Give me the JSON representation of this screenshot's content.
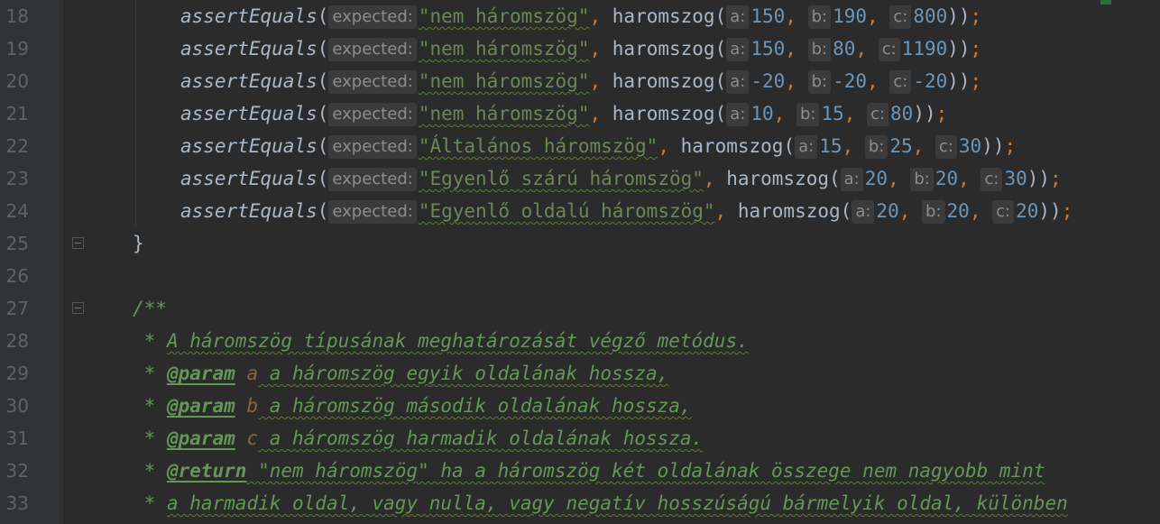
{
  "editor": {
    "lines": [
      {
        "num": "18",
        "method": "assertEquals",
        "hint_expected": "expected:",
        "expected": "\"nem háromszög\"",
        "func": "haromszog",
        "a": "150",
        "b": "190",
        "c": "800",
        "close": "));"
      },
      {
        "num": "19",
        "method": "assertEquals",
        "hint_expected": "expected:",
        "expected": "\"nem háromszög\"",
        "func": "haromszog",
        "a": "150",
        "b": "80",
        "c": "1190",
        "close": "));"
      },
      {
        "num": "20",
        "method": "assertEquals",
        "hint_expected": "expected:",
        "expected": "\"nem háromszög\"",
        "func": "haromszog",
        "a": "-20",
        "b": "-20",
        "c": "-20",
        "close": "));"
      },
      {
        "num": "21",
        "method": "assertEquals",
        "hint_expected": "expected:",
        "expected": "\"nem háromszög\"",
        "func": "haromszog",
        "a": "10",
        "b": "15",
        "c": "80",
        "close": "));"
      },
      {
        "num": "22",
        "method": "assertEquals",
        "hint_expected": "expected:",
        "expected": "\"Általános háromszög\"",
        "func": "haromszog",
        "a": "15",
        "b": "25",
        "c": "30",
        "close": "));"
      },
      {
        "num": "23",
        "method": "assertEquals",
        "hint_expected": "expected:",
        "expected": "\"Egyenlő szárú háromszög\"",
        "func": "haromszog",
        "a": "20",
        "b": "20",
        "c": "30",
        "close": "));"
      },
      {
        "num": "24",
        "method": "assertEquals",
        "hint_expected": "expected:",
        "expected": "\"Egyenlő oldalú háromszög\"",
        "func": "haromszog",
        "a": "20",
        "b": "20",
        "c": "20",
        "close": "));"
      }
    ],
    "hint_a": "a:",
    "hint_b": "b:",
    "hint_c": "c:",
    "comma": ",",
    "open_paren": "(",
    "line25": {
      "num": "25",
      "text": "}"
    },
    "line26": {
      "num": "26"
    },
    "line27": {
      "num": "27",
      "text": "/**"
    },
    "line28": {
      "num": "28",
      "star": " * ",
      "text": "A háromszög típusának meghatározását végző metódus."
    },
    "line29": {
      "num": "29",
      "star": " * ",
      "tag": "@param",
      "name": "a",
      "text": " a háromszög egyik oldalának hossza,"
    },
    "line30": {
      "num": "30",
      "star": " * ",
      "tag": "@param",
      "name": "b",
      "text": " a háromszög második oldalának hossza,"
    },
    "line31": {
      "num": "31",
      "star": " * ",
      "tag": "@param",
      "name": "c",
      "text": " a háromszög harmadik oldalának hossza."
    },
    "line32": {
      "num": "32",
      "star": " * ",
      "tag": "@return",
      "text": " \"nem háromszög\" ha a háromszög két oldalának összege nem nagyobb mint"
    },
    "line33": {
      "num": "33",
      "star": " * ",
      "text": "a harmadik oldal, vagy nulla, vagy negatív hosszúságú bármelyik oldal, különben"
    }
  },
  "colors": {
    "background": "#2b2b2b",
    "gutter": "#313335",
    "string": "#6a8759",
    "number": "#6897bb",
    "keyword": "#cc7832",
    "doc": "#629755"
  }
}
